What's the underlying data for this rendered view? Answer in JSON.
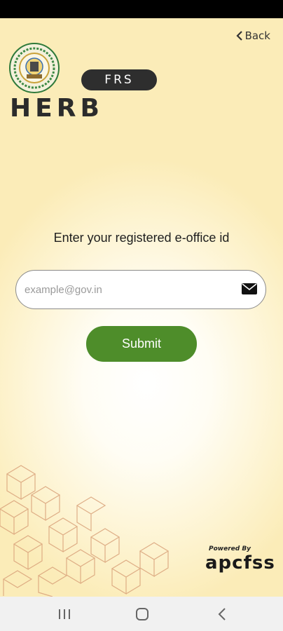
{
  "header": {
    "back_label": "Back"
  },
  "logo": {
    "badge_text": "FRS",
    "wordmark": "HERB"
  },
  "form": {
    "prompt": "Enter your registered e-office id",
    "email_placeholder": "example@gov.in",
    "email_value": "",
    "submit_label": "Submit"
  },
  "footer": {
    "powered_by": "Powered By",
    "brand": "apcfss"
  },
  "nav": {
    "icons": [
      "recent-apps-icon",
      "home-icon",
      "back-icon"
    ]
  },
  "colors": {
    "accent": "#4e8d2a",
    "background": "#fdf3cf",
    "pattern": "#d9a27a"
  }
}
